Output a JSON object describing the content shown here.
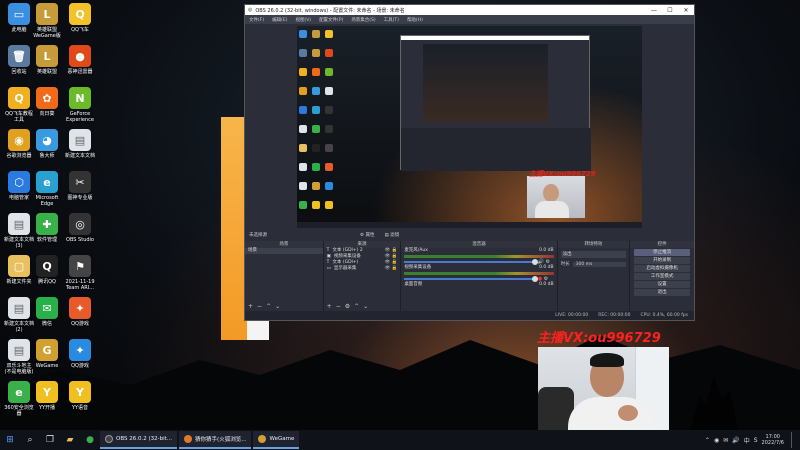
{
  "desktop": {
    "icons": [
      {
        "label": "此电脑",
        "glyph": "▭",
        "color": "#3b8fe0"
      },
      {
        "label": "英雄联盟\nWeGame版",
        "glyph": "L",
        "color": "#c79a3a"
      },
      {
        "label": "QQ飞车",
        "glyph": "Q",
        "color": "#f3c12a"
      },
      {
        "label": "回收站",
        "glyph": "🗑",
        "color": "#5a7aa0"
      },
      {
        "label": "英雄联盟",
        "glyph": "L",
        "color": "#c79a3a"
      },
      {
        "label": "恶神迅雷器",
        "glyph": "●",
        "color": "#e04a1a"
      },
      {
        "label": "QQ飞车教程\n工具",
        "glyph": "Q",
        "color": "#f0b020"
      },
      {
        "label": "向日葵",
        "glyph": "✿",
        "color": "#f06a1a"
      },
      {
        "label": "GeForce\nExperience",
        "glyph": "N",
        "color": "#6cba2a"
      },
      {
        "label": "谷歌浏览器",
        "glyph": "◉",
        "color": "#e0a020"
      },
      {
        "label": "鲁大师",
        "glyph": "◕",
        "color": "#3a9ae0"
      },
      {
        "label": "新建文本文档",
        "glyph": "▤",
        "color": "#dfe3ea"
      },
      {
        "label": "电脑管家",
        "glyph": "⬡",
        "color": "#2a7ae0"
      },
      {
        "label": "Microsoft\nEdge",
        "glyph": "e",
        "color": "#2aa0d0"
      },
      {
        "label": "图神专业版",
        "glyph": "✂",
        "color": "#333333"
      },
      {
        "label": "新建文本文档\n(3)",
        "glyph": "▤",
        "color": "#dfe3ea"
      },
      {
        "label": "软件管理",
        "glyph": "✚",
        "color": "#3ab04a"
      },
      {
        "label": "OBS Studio",
        "glyph": "◎",
        "color": "#333333"
      },
      {
        "label": "新建文件夹",
        "glyph": "▢",
        "color": "#e8c060"
      },
      {
        "label": "腾讯QQ",
        "glyph": "Q",
        "color": "#222222"
      },
      {
        "label": "2021-11-19\nTeam ARI...",
        "glyph": "⚑",
        "color": "#444444"
      },
      {
        "label": "新建文本文档\n(2)",
        "glyph": "▤",
        "color": "#dfe3ea"
      },
      {
        "label": "微信",
        "glyph": "✉",
        "color": "#2ab04a"
      },
      {
        "label": "QQ游戏",
        "glyph": "✦",
        "color": "#e85a2a"
      },
      {
        "label": "双乐斗地主\n(不是电脑版)",
        "glyph": "▤",
        "color": "#dfe3ea"
      },
      {
        "label": "WeGame",
        "glyph": "G",
        "color": "#d0a030"
      },
      {
        "label": "QQ游戏",
        "glyph": "✦",
        "color": "#2a8ae0"
      },
      {
        "label": "360安全浏览\n器",
        "glyph": "e",
        "color": "#3ab04a"
      },
      {
        "label": "YY开播",
        "glyph": "Y",
        "color": "#f0c020"
      },
      {
        "label": "YY语音",
        "glyph": "Y",
        "color": "#f0c020"
      }
    ]
  },
  "obs": {
    "title": "OBS 26.0.2 (32-bit, windows) - 配置文件: 未命名 - 场景: 未命名",
    "menu": [
      "文件(F)",
      "编辑(E)",
      "视图(V)",
      "配置文件(P)",
      "场景集合(S)",
      "工具(T)",
      "帮助(H)"
    ],
    "preview_overlay": "主播VX:ou996729",
    "scene_label": "未选择源",
    "scene_tools": [
      "⚙ 属性",
      "▤ 滤镜"
    ],
    "docks": {
      "scenes": {
        "title": "场景",
        "items": [
          "场景"
        ]
      },
      "sources": {
        "title": "来源",
        "items": [
          "文本 (GDI+) 2",
          "视频采集设备",
          "文本 (GDI+)",
          "显示器采集"
        ]
      },
      "mixer": {
        "title": "混音器",
        "channels": [
          {
            "name": "麦克风/Aux",
            "db": "0.0 dB"
          },
          {
            "name": "视频采集设备",
            "db": "0.0 dB"
          },
          {
            "name": "桌面音频",
            "db": "0.0 dB"
          }
        ]
      },
      "transitions": {
        "title": "转场特效",
        "select": "淡出",
        "duration_label": "时长",
        "duration": "300 ms"
      },
      "controls": {
        "title": "控件",
        "buttons": [
          "停止推流",
          "开始录制",
          "启动虚拟摄像机",
          "工作室模式",
          "设置",
          "退出"
        ]
      }
    },
    "status": [
      "LIVE: 00:00:00",
      "REC: 00:00:00",
      "CPU: 0.4%, 60.00 fps"
    ]
  },
  "overlay_text": "主播VX:ou996729",
  "taskbar": {
    "apps": [
      {
        "label": "OBS 26.0.2 (32-bit...",
        "color": "#444"
      },
      {
        "label": "猜你猜手(火狐浏览...",
        "color": "#e07a2a"
      },
      {
        "label": "WeGame",
        "color": "#d0a030"
      }
    ],
    "tray_icons": [
      "⌃",
      "◉",
      "✉",
      "🔊",
      "中",
      "S"
    ],
    "time": "17:00",
    "date": "2022/7/6"
  }
}
